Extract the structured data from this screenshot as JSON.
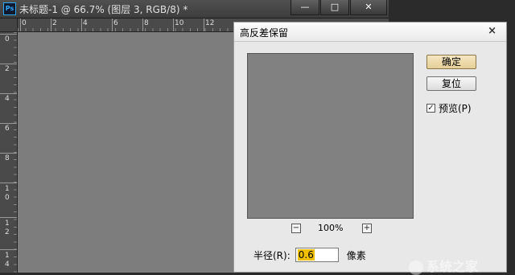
{
  "window": {
    "app_logo": "Ps",
    "title": "未标题-1 @ 66.7% (图层 3, RGB/8) *",
    "buttons": {
      "minimize": "—",
      "maximize": "□",
      "close": "✕"
    }
  },
  "rulers": {
    "horizontal_labels": [
      "0",
      "2",
      "4",
      "6",
      "8",
      "10",
      "12"
    ],
    "vertical_labels": [
      "0",
      "2",
      "4",
      "6",
      "8",
      "1 0",
      "1 2",
      "1 4"
    ]
  },
  "dialog": {
    "title": "高反差保留",
    "close": "×",
    "ok_label": "确定",
    "reset_label": "复位",
    "preview_label": "预览(P)",
    "preview_checked": true,
    "zoom_minus": "−",
    "zoom_plus": "+",
    "zoom_level": "100%",
    "radius_label": "半径(R):",
    "radius_value": "0.6",
    "radius_unit": "像素"
  },
  "watermark": "系统之家",
  "colors": {
    "canvas": "#7d7d7d",
    "preview": "#818181",
    "ok_button": "#e6cf97",
    "input_highlight": "#f0c000"
  }
}
